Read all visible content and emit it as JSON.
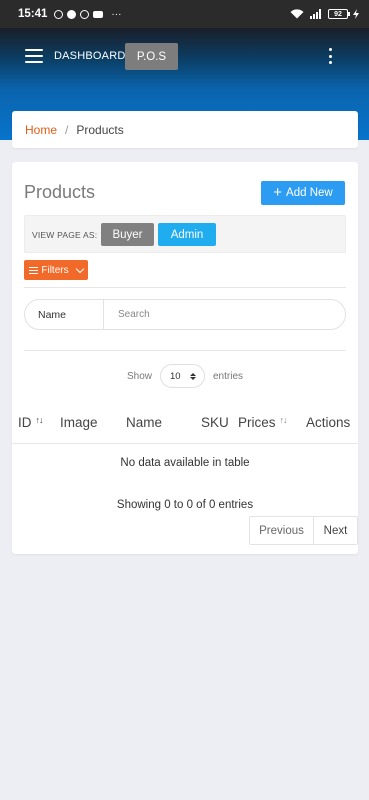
{
  "status_bar": {
    "time": "15:41",
    "more": "···",
    "battery": "92"
  },
  "header": {
    "dashboard_label": "DASHBOARD",
    "pos_label": "P.O.S"
  },
  "breadcrumb": {
    "home": "Home",
    "separator": "/",
    "current": "Products"
  },
  "main": {
    "title": "Products",
    "add_new_label": "Add New",
    "view_as_label": "VIEW PAGE AS:",
    "buyer_label": "Buyer",
    "admin_label": "Admin",
    "filters_label": "Filters",
    "search": {
      "label": "Name",
      "placeholder": "Search"
    },
    "show_label": "Show",
    "page_length": "10",
    "entries_label": "entries"
  },
  "table": {
    "columns": [
      "ID",
      "Image",
      "Name",
      "SKU",
      "Prices",
      "Actions"
    ],
    "empty_message": "No data available in table",
    "info": "Showing 0 to 0 of 0 entries",
    "pagination": {
      "previous": "Previous",
      "next": "Next"
    }
  },
  "colors": {
    "header_blue": "#0874cc",
    "add_button": "#2c9cf2",
    "admin_button": "#20adf0",
    "buyer_button": "#808080",
    "filters_button": "#f26a2a",
    "breadcrumb_home": "#e05e17"
  }
}
